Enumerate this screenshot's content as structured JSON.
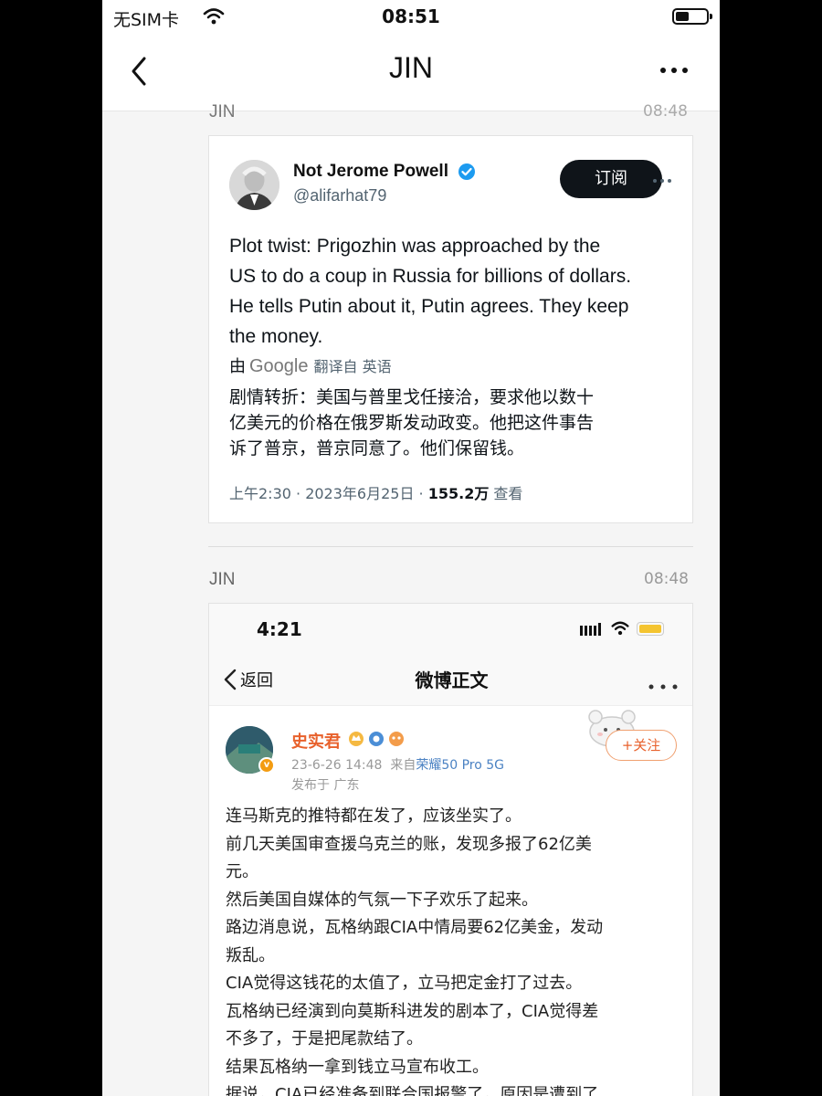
{
  "status_bar": {
    "carrier": "无SIM卡",
    "time": "08:51"
  },
  "nav": {
    "title": "JIN"
  },
  "prev_message": {
    "sender": "JIN",
    "time": "08:48"
  },
  "tweet": {
    "name": "Not Jerome Powell",
    "handle": "@alifarhat79",
    "subscribe_label": "订阅",
    "text_lines": [
      "Plot twist: Prigozhin was approached by the",
      "US to do a coup in Russia for billions of dollars.",
      "He tells Putin about it, Putin agrees. They keep",
      "the money."
    ],
    "translate_prefix": "由",
    "translate_engine": "Google",
    "translate_suffix": "翻译自 英语",
    "translated_lines": [
      "剧情转折：美国与普里戈任接洽，要求他以数十",
      "亿美元的价格在俄罗斯发动政变。他把这件事告",
      "诉了普京，普京同意了。他们保留钱。"
    ],
    "meta_time": "上午2:30 · 2023年6月25日 · ",
    "meta_views": "155.2万",
    "meta_views_label": " 查看"
  },
  "message2": {
    "sender": "JIN",
    "time": "08:48"
  },
  "weibo": {
    "status_time": "4:21",
    "back_label": "返回",
    "title": "微博正文",
    "author": "史实君",
    "date": "23-6-26 14:48",
    "source_prefix": "来自",
    "source_brand": "荣耀50 Pro 5G",
    "location": "发布于 广东",
    "follow_label": "+关注",
    "body_lines": [
      "连马斯克的推特都在发了，应该坐实了。",
      "前几天美国审查援乌克兰的账，发现多报了62亿美",
      "元。",
      "然后美国自媒体的气氛一下子欢乐了起来。",
      "路边消息说，瓦格纳跟CIA中情局要62亿美金，发动",
      "叛乱。",
      "CIA觉得这钱花的太值了，立马把定金打了过去。",
      "瓦格纳已经演到向莫斯科进发的剧本了，CIA觉得差",
      "不多了，于是把尾款结了。",
      "结果瓦格纳一拿到钱立马宣布收工。",
      "据说，CIA已经准备到联合国报警了，原因是遭到了"
    ]
  }
}
